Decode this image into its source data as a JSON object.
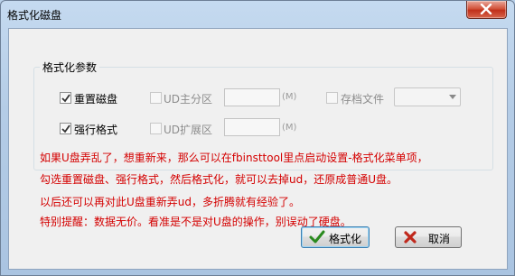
{
  "window": {
    "title": "格式化磁盘"
  },
  "group": {
    "label": "格式化参数"
  },
  "options": {
    "reset_disk": {
      "label": "重置磁盘",
      "checked": true
    },
    "force_format": {
      "label": "强行格式",
      "checked": true
    },
    "ud_main": {
      "label": "UD主分区",
      "unit": "(M)",
      "value": ""
    },
    "ud_ext": {
      "label": "UD扩展区",
      "unit": "(M)",
      "value": ""
    },
    "archive": {
      "label": "存档文件",
      "selected": ""
    }
  },
  "notes": [
    "如果U盘弄乱了，想重新来，那么可以在fbinsttool里点启动设置-格式化菜单项，",
    "勾选重置磁盘、强行格式，然后格式化，就可以去掉ud，还原成普通U盘。",
    "以后还可以再对此U盘重新弄ud，多折腾就有经验了。",
    "特别提醒：数据无价。看准是不是对U盘的操作，别误动了硬盘。"
  ],
  "buttons": {
    "format": "格式化",
    "cancel": "取消"
  },
  "colors": {
    "note_text": "#d40000",
    "check_icon": "#2a8a1e",
    "cancel_icon": "#c0281c"
  }
}
